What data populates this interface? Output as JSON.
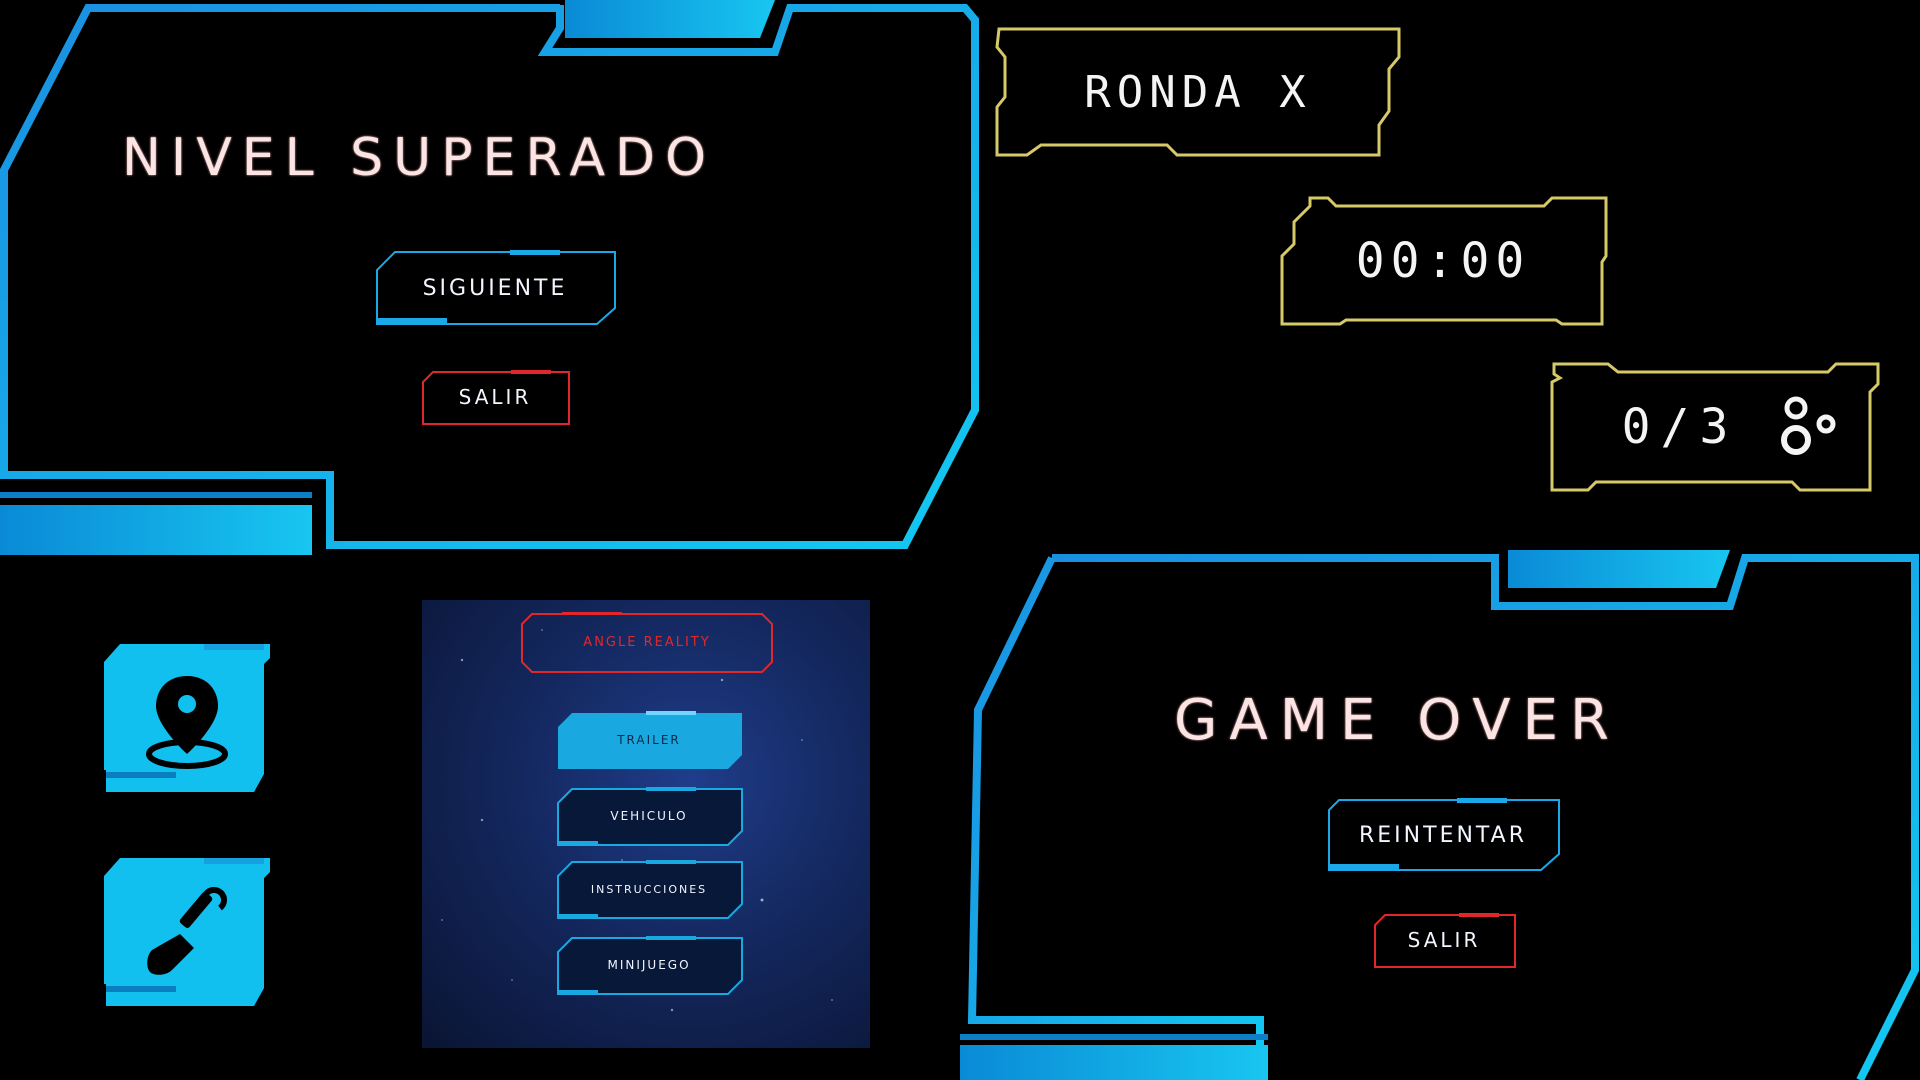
{
  "level_complete": {
    "title": "NIVEL SUPERADO",
    "next_button": "SIGUIENTE",
    "exit_button": "SALIR"
  },
  "hud": {
    "round_label": "RONDA X",
    "timer": "00:00",
    "counter": "0/3",
    "counter_icon": "gears-icon"
  },
  "side_icons": [
    {
      "icon": "map-pin-icon"
    },
    {
      "icon": "shovel-icon"
    }
  ],
  "main_menu": {
    "title": "ANGLE REALITY",
    "items": [
      "TRAILER",
      "VEHICULO",
      "INSTRUCCIONES",
      "MINIJUEGO"
    ]
  },
  "game_over": {
    "title": "GAME OVER",
    "retry_button": "REINTENTAR",
    "exit_button": "SALIR"
  },
  "colors": {
    "frame_blue": "#0b9fe0",
    "frame_cyan": "#12c6f0",
    "hud_gold": "#d6c96a",
    "exit_red": "#e0282a",
    "title_pink": "#fbe4e4",
    "icon_fill": "#12c0f0"
  }
}
